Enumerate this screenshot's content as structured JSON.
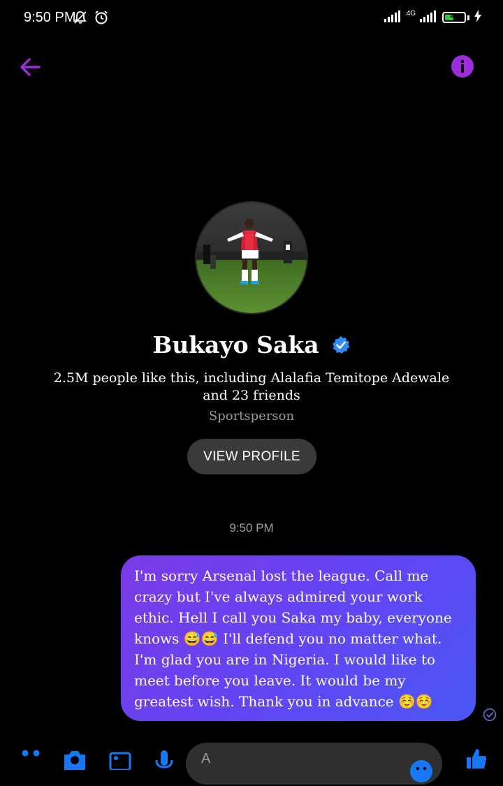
{
  "status_bar": {
    "time": "9:50 PM",
    "network": "4G",
    "battery": "45",
    "battery_level": 0.45
  },
  "header": {
    "back_icon": "arrow-left-icon",
    "info_icon": "info-icon",
    "accent_color": "#9b2ed9"
  },
  "profile": {
    "name": "Bukayo Saka",
    "verified": true,
    "likes": "2.5M people like this, including Alalafia Temitope Adewale and 23 friends",
    "category": "Sportsperson",
    "view_profile_label": "VIEW PROFILE"
  },
  "conversation": {
    "timestamp": "9:50 PM",
    "messages": [
      {
        "text": "I'm sorry Arsenal lost the league. Call me crazy but I've always admired your work ethic. Hell I call you Saka my baby, everyone knows 😅😅 I'll defend you no matter what. I'm glad you are in Nigeria. I would like to meet before you leave. It would be my greatest wish. Thank you in advance ☺️☺️",
        "from_me": true,
        "status": "sent"
      }
    ]
  },
  "composer": {
    "icons": [
      "menu-dots-icon",
      "camera-icon",
      "gallery-icon",
      "microphone-icon",
      "emoji-icon",
      "like-thumb-icon"
    ],
    "input_placeholder": "A",
    "icon_color": "#1877f2"
  }
}
